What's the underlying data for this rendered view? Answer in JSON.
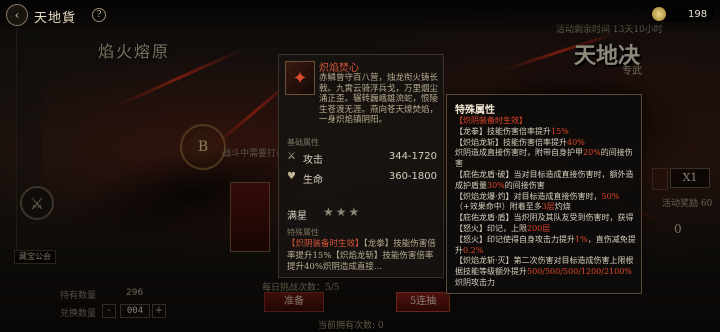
{
  "header": {
    "title": "天地貨",
    "help_glyph": "?",
    "back_glyph": "‹",
    "currency_value": "198",
    "banner_left": "焰火熔原",
    "event_timer": "活动剩余时间 13天10小时",
    "banner_right": "天地决",
    "right_tag": "专武"
  },
  "left": {
    "disc_label": "B",
    "disc_text": "战斗中需要打击",
    "shop_label": "藏宝公会",
    "stats": [
      {
        "label": "持有数量",
        "value": "296"
      },
      {
        "label": "兑换数量",
        "value": "004"
      }
    ]
  },
  "item": {
    "name": "炽焰焚心",
    "description": "赤鳞曾守百八营，烛龙衔火铸长戟。九霄云骑浮兵戈，万里烟尘涌正歪。辗转巍峨雄流蛇，恨陵生苍渡无涯。燕向苍天燎焚焰，一身炽焰镇阴阳。",
    "section_base": "基础属性",
    "attributes": [
      {
        "icon": "attack-icon",
        "glyph": "⚔",
        "name": "攻击",
        "value": "344-1720"
      },
      {
        "icon": "hp-icon",
        "glyph": "♥",
        "name": "生命",
        "value": "360-1800"
      }
    ],
    "star_label": "满星",
    "stars": "★★★",
    "section_special": "特殊属性",
    "effect_header": "【炽阴装备时生效】",
    "effect_text": "【龙拳】技能伤害倍率提升15%【炽焰龙斩】技能伤害倍率提升40%炽阴造成直接...",
    "icon_glyph": "✦"
  },
  "tooltip": {
    "title": "特殊属性",
    "lines": [
      {
        "text": "【炽阴装备时生效】",
        "style": "red"
      },
      {
        "text": "【龙拳】技能伤害倍率提升15%",
        "style": "mixed-a"
      },
      {
        "text": "【炽焰龙斩】技能伤害倍率提升40%",
        "style": "mixed-b"
      },
      {
        "text": "炽阴造成直接伤害时，附带自身护甲20%的间接伤害",
        "style": "mixed-c"
      },
      {
        "text": "【庇佑龙盾·破】当对目标造成直接伤害时，额外造成护盾量30%的间接伤害",
        "style": "mixed-d"
      },
      {
        "text": "【炽焰龙爆·灼】对目标造成直接伤害时，50%（+效果命中）附着至多3层灼烧",
        "style": "mixed-e"
      },
      {
        "text": "【庇佑龙盾·盾】当炽阴及其队友受到伤害时，获得【怒火】印记，上限200层",
        "style": "plain"
      },
      {
        "text": "【怒火】印记使得自身攻击力提升1%，直伤减免提升0.2%",
        "style": "mixed-f"
      },
      {
        "text": "【炽焰龙斩·灭】第二次伤害对目标造成伤害上限根据技能等级额外提升500/500/500/1200/2100%",
        "style": "mixed-g"
      },
      {
        "text": "炽阴攻击力",
        "style": "plain"
      }
    ]
  },
  "bottom": {
    "caption": "当前拥有次数: 0",
    "attempts": "每日挑战次数：5/5",
    "ready_label": "准备",
    "red_label": "5连抽",
    "badge_x1": "X1",
    "reward_label": "活动奖励 60",
    "reward_num": "0",
    "count": "1"
  },
  "colors": {
    "accent_red": "#e0452a",
    "gold": "#d8cfbf",
    "panel_bg": "#16130f"
  }
}
